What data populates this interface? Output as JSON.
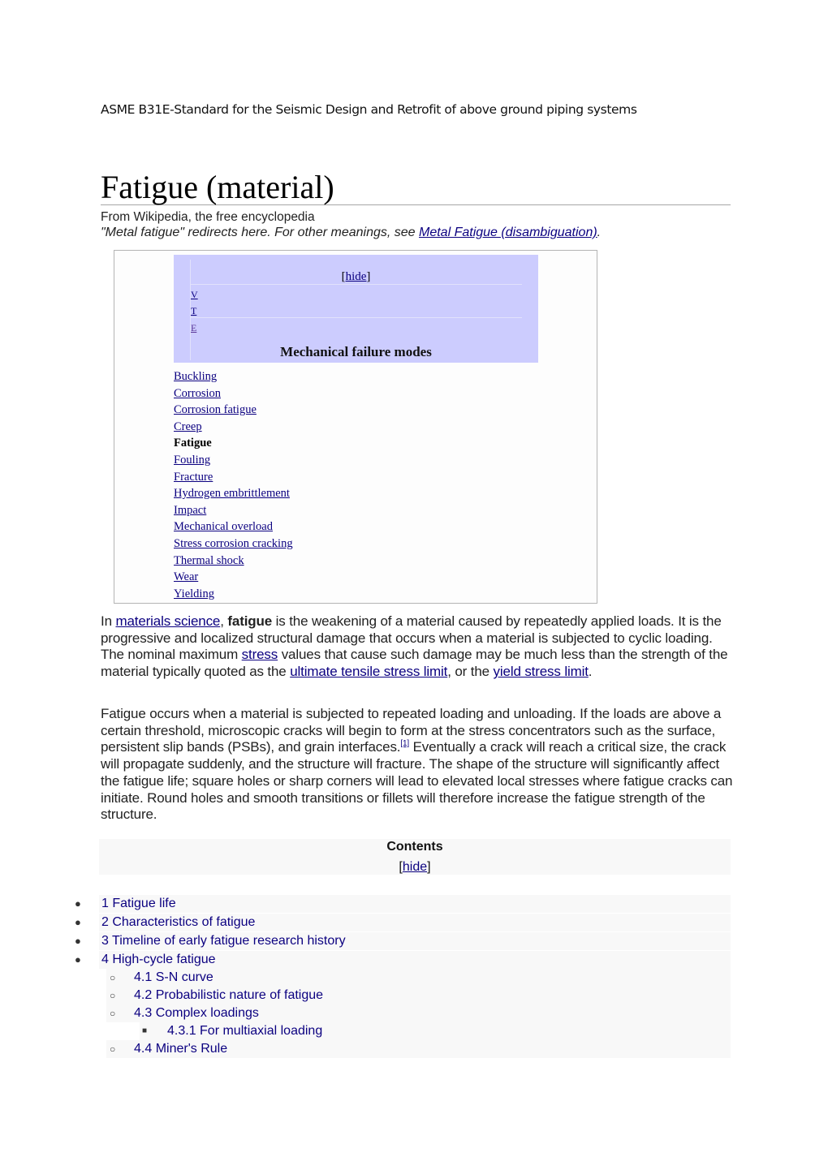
{
  "document_header": "ASME B31E-Standard for the Seismic Design and Retrofit of above ground piping systems",
  "article": {
    "title": "Fatigue (material)",
    "subtitle": "From Wikipedia, the free encyclopedia",
    "hatnote": {
      "prefix": "\"Metal fatigue\" redirects here. For other meanings, see ",
      "link": "Metal Fatigue (disambiguation)",
      "suffix": "."
    }
  },
  "navbox": {
    "hide_open": "[",
    "hide_label": "hide",
    "hide_close": "]",
    "vte": [
      "V",
      "T",
      "E"
    ],
    "title": "Mechanical failure modes",
    "items": [
      {
        "label": "Buckling",
        "current": false
      },
      {
        "label": "Corrosion",
        "current": false
      },
      {
        "label": "Corrosion fatigue",
        "current": false
      },
      {
        "label": "Creep",
        "current": false
      },
      {
        "label": "Fatigue",
        "current": true
      },
      {
        "label": "Fouling",
        "current": false
      },
      {
        "label": "Fracture",
        "current": false
      },
      {
        "label": "Hydrogen embrittlement",
        "current": false
      },
      {
        "label": "Impact",
        "current": false
      },
      {
        "label": "Mechanical overload",
        "current": false
      },
      {
        "label": "Stress corrosion cracking",
        "current": false
      },
      {
        "label": "Thermal shock",
        "current": false
      },
      {
        "label": "Wear",
        "current": false
      },
      {
        "label": "Yielding",
        "current": false
      }
    ]
  },
  "paragraph1": {
    "t1": "In ",
    "link1": "materials science",
    "t2": ", ",
    "bold": "fatigue",
    "t3": " is the weakening of a material caused by repeatedly applied loads. It is the progressive and localized structural damage that occurs when a material is subjected to cyclic loading. The nominal maximum ",
    "link2": "stress",
    "t4": " values that cause such damage may be much less than the strength of the material typically quoted as the ",
    "link3": "ultimate tensile stress limit",
    "t5": ", or the ",
    "link4": "yield stress limit",
    "t6": "."
  },
  "paragraph2": {
    "t1": "Fatigue occurs when a material is subjected to repeated loading and unloading. If the loads are above a certain threshold, microscopic cracks will begin to form at the stress concentrators such as the surface, persistent slip bands (PSBs), and grain interfaces.",
    "ref": "[1]",
    "t2": " Eventually a crack will reach a critical size, the crack will propagate suddenly, and the structure will fracture. The shape of the structure will significantly affect the fatigue life; square holes or sharp corners will lead to elevated local stresses where fatigue cracks can initiate. Round holes and smooth transitions or fillets will therefore increase the fatigue strength of the structure."
  },
  "toc": {
    "title": "Contents",
    "hide_open": "[",
    "hide_label": "hide",
    "hide_close": "]",
    "items": [
      {
        "label": "1 Fatigue life",
        "level": 1,
        "bullet": "●"
      },
      {
        "label": "2 Characteristics of fatigue",
        "level": 1,
        "bullet": "●"
      },
      {
        "label": "3 Timeline of early fatigue research history",
        "level": 1,
        "bullet": "●"
      },
      {
        "label": "4 High-cycle fatigue",
        "level": 1,
        "bullet": "●"
      },
      {
        "label": "4.1 S-N curve",
        "level": 2,
        "bullet": "○"
      },
      {
        "label": "4.2 Probabilistic nature of fatigue",
        "level": 2,
        "bullet": "○"
      },
      {
        "label": "4.3 Complex loadings",
        "level": 2,
        "bullet": "○"
      },
      {
        "label": "4.3.1 For multiaxial loading",
        "level": 3,
        "bullet": "■"
      },
      {
        "label": "4.4 Miner's Rule",
        "level": 2,
        "bullet": "○"
      }
    ]
  }
}
